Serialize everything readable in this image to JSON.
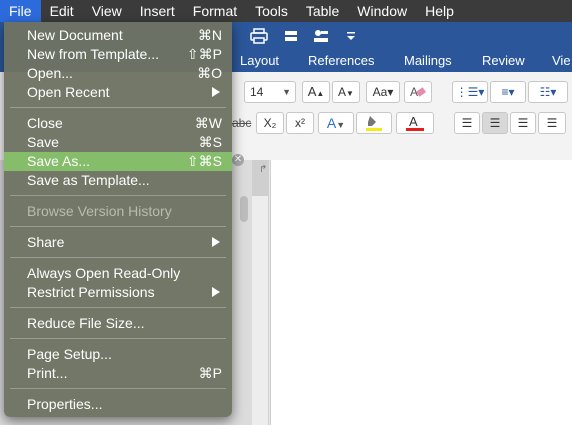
{
  "menubar": {
    "items": [
      {
        "label": "File"
      },
      {
        "label": "Edit"
      },
      {
        "label": "View"
      },
      {
        "label": "Insert"
      },
      {
        "label": "Format"
      },
      {
        "label": "Tools"
      },
      {
        "label": "Table"
      },
      {
        "label": "Window"
      },
      {
        "label": "Help"
      }
    ]
  },
  "ribbon": {
    "tabs": [
      {
        "label": "Layout"
      },
      {
        "label": "References"
      },
      {
        "label": "Mailings"
      },
      {
        "label": "Review"
      },
      {
        "label": "Vie"
      }
    ],
    "font_size": "14",
    "subscript_label": "X₂",
    "superscript_label": "x²",
    "strikethrough_label": "abc",
    "font_color": "#e3201b",
    "highlight_color": "#f5e81b",
    "accent_color": "#2b579a"
  },
  "file_menu": {
    "items": [
      {
        "label": "New Document",
        "shortcut": "⌘N"
      },
      {
        "label": "New from Template...",
        "shortcut": "⇧⌘P"
      },
      {
        "label": "Open...",
        "shortcut": "⌘O"
      },
      {
        "label": "Open Recent",
        "shortcut": ""
      },
      {
        "label": "Close",
        "shortcut": "⌘W"
      },
      {
        "label": "Save",
        "shortcut": "⌘S"
      },
      {
        "label": "Save As...",
        "shortcut": "⇧⌘S"
      },
      {
        "label": "Save as Template...",
        "shortcut": ""
      },
      {
        "label": "Browse Version History",
        "shortcut": ""
      },
      {
        "label": "Share",
        "shortcut": ""
      },
      {
        "label": "Always Open Read-Only",
        "shortcut": ""
      },
      {
        "label": "Restrict Permissions",
        "shortcut": ""
      },
      {
        "label": "Reduce File Size...",
        "shortcut": ""
      },
      {
        "label": "Page Setup...",
        "shortcut": ""
      },
      {
        "label": "Print...",
        "shortcut": "⌘P"
      },
      {
        "label": "Properties...",
        "shortcut": ""
      }
    ],
    "highlight_color": "#86bd6a"
  }
}
